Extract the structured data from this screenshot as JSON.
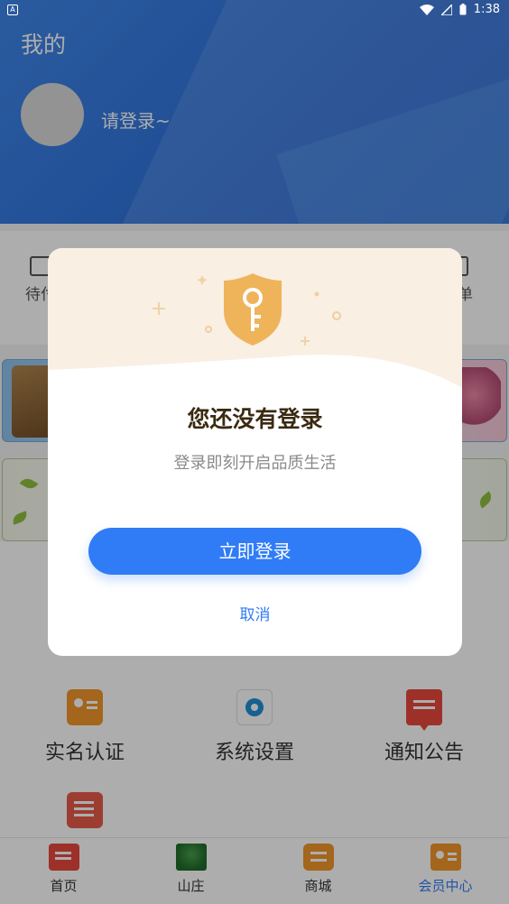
{
  "status_bar": {
    "time": "1:38",
    "notification_icon": "a-icon"
  },
  "header": {
    "title": "我的",
    "login_prompt": "请登录~"
  },
  "orders": {
    "left_label_partial": "待付",
    "right_label_partial": "订单"
  },
  "services": [
    {
      "label": "实名认证",
      "icon": "id-card-icon"
    },
    {
      "label": "系统设置",
      "icon": "gear-icon"
    },
    {
      "label": "通知公告",
      "icon": "announcement-icon"
    }
  ],
  "bottom_nav": {
    "items": [
      {
        "label": "首页",
        "icon": "home-icon",
        "active": false
      },
      {
        "label": "山庄",
        "icon": "villa-icon",
        "active": false
      },
      {
        "label": "商城",
        "icon": "mall-icon",
        "active": false
      },
      {
        "label": "会员中心",
        "icon": "member-icon",
        "active": true
      }
    ]
  },
  "dialog": {
    "title": "您还没有登录",
    "subtitle": "登录即刻开启品质生活",
    "login_button": "立即登录",
    "cancel_button": "取消",
    "icon": "key-shield-icon"
  },
  "colors": {
    "primary": "#2f7cf6",
    "header_blue": "#2f72dc",
    "dialog_top_bg": "#f9efe3",
    "shield_gold": "#efb45a"
  }
}
